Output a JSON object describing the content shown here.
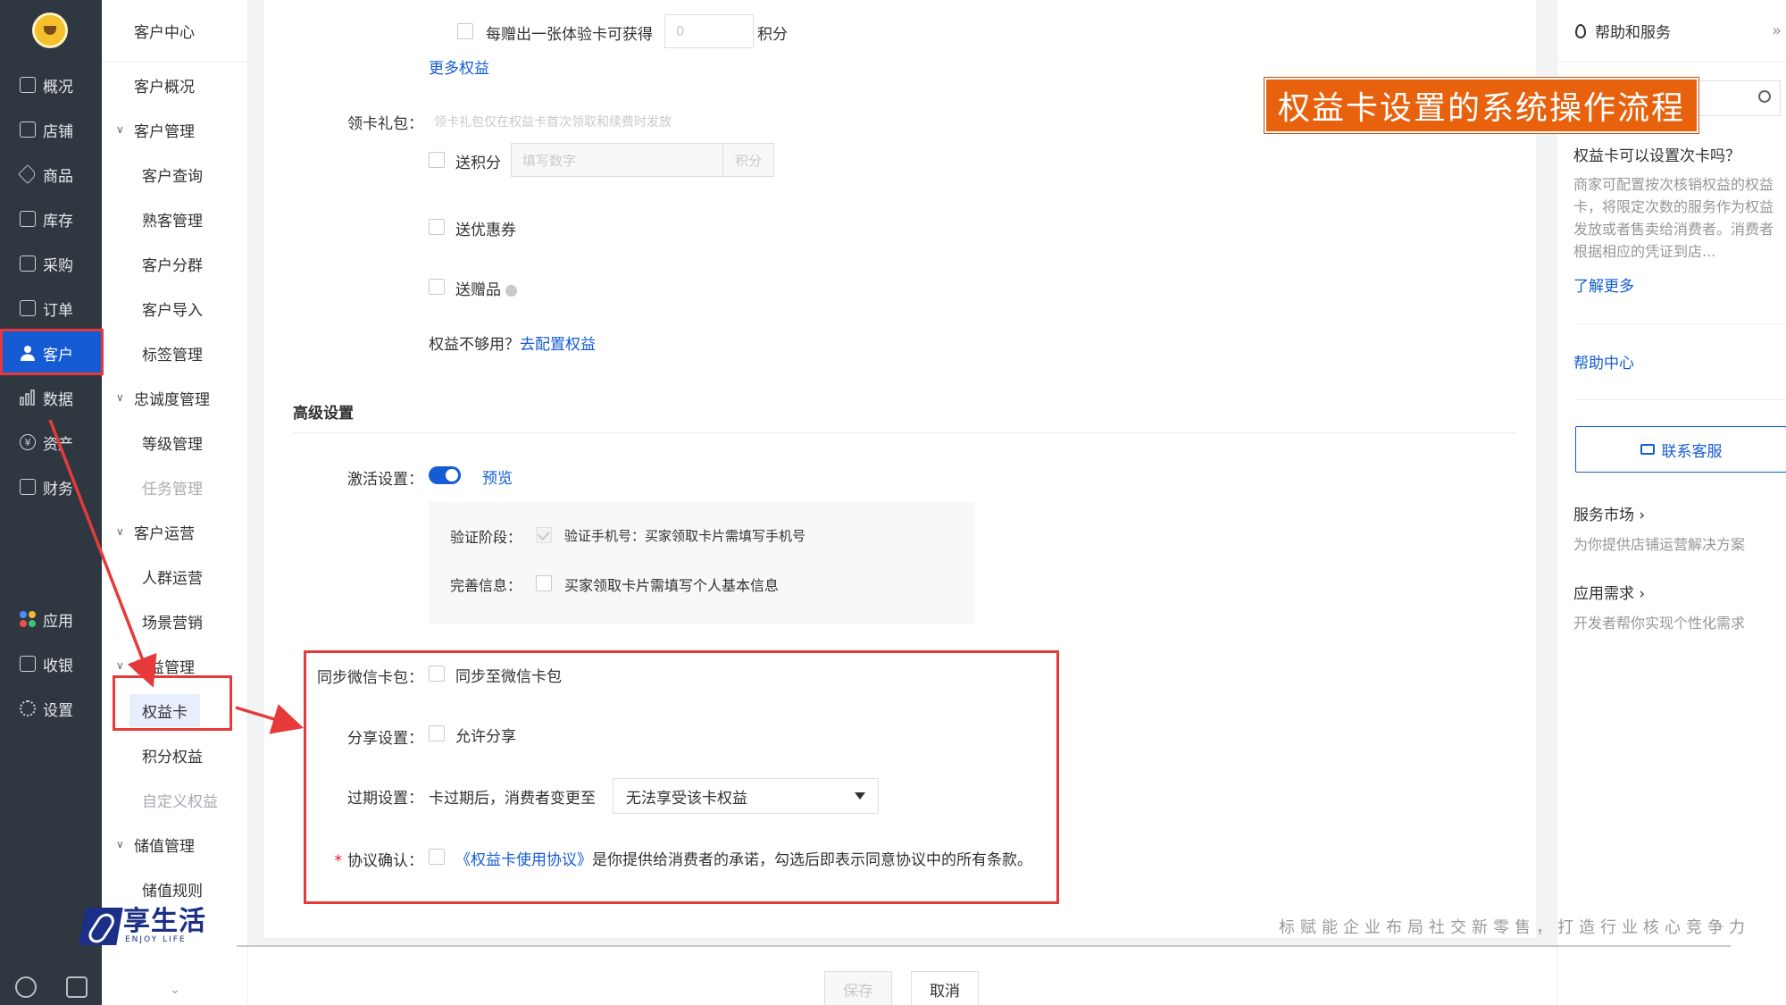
{
  "left_nav": {
    "items": [
      {
        "label": "概况",
        "icon": "monitor-icon"
      },
      {
        "label": "店铺",
        "icon": "store-icon"
      },
      {
        "label": "商品",
        "icon": "tag-icon"
      },
      {
        "label": "库存",
        "icon": "warehouse-icon"
      },
      {
        "label": "采购",
        "icon": "purchase-icon"
      },
      {
        "label": "订单",
        "icon": "list-icon"
      },
      {
        "label": "客户",
        "icon": "user-icon",
        "active": true
      },
      {
        "label": "数据",
        "icon": "bar-chart-icon"
      },
      {
        "label": "资产",
        "icon": "yen-icon"
      },
      {
        "label": "财务",
        "icon": "finance-icon"
      },
      {
        "label": "应用",
        "icon": "apps-icon"
      },
      {
        "label": "收银",
        "icon": "cashier-icon"
      },
      {
        "label": "设置",
        "icon": "gear-icon"
      }
    ],
    "bottom_icons": [
      "search-icon",
      "message-icon"
    ],
    "accent": "#155bd4"
  },
  "sub_nav": {
    "header": "客户中心",
    "items": [
      {
        "label": "客户概况",
        "kind": "top"
      },
      {
        "label": "客户管理",
        "kind": "group"
      },
      {
        "label": "客户查询",
        "kind": "leaf"
      },
      {
        "label": "熟客管理",
        "kind": "leaf"
      },
      {
        "label": "客户分群",
        "kind": "leaf"
      },
      {
        "label": "客户导入",
        "kind": "leaf"
      },
      {
        "label": "标签管理",
        "kind": "leaf"
      },
      {
        "label": "忠诚度管理",
        "kind": "group"
      },
      {
        "label": "等级管理",
        "kind": "leaf"
      },
      {
        "label": "任务管理",
        "kind": "leaf",
        "disabled": true
      },
      {
        "label": "客户运营",
        "kind": "group"
      },
      {
        "label": "人群运营",
        "kind": "leaf"
      },
      {
        "label": "场景营销",
        "kind": "leaf"
      },
      {
        "label": "权益管理",
        "kind": "group"
      },
      {
        "label": "权益卡",
        "kind": "leaf",
        "selected": true
      },
      {
        "label": "积分权益",
        "kind": "leaf"
      },
      {
        "label": "自定义权益",
        "kind": "leaf",
        "disabled": true
      },
      {
        "label": "储值管理",
        "kind": "group"
      },
      {
        "label": "储值规则",
        "kind": "leaf"
      }
    ],
    "more": "⌄"
  },
  "form": {
    "trial_card_checkbox_label": "每赠出一张体验卡可获得",
    "trial_card_points_value": "0",
    "trial_card_points_unit": "积分",
    "more_rights_link": "更多权益",
    "gift_pack_label": "领卡礼包：",
    "gift_pack_hint": "领卡礼包仅在权益卡首次领取和续费时发放",
    "send_points_label": "送积分",
    "send_points_placeholder": "填写数字",
    "send_points_unit": "积分",
    "send_coupon_label": "送优惠券",
    "send_gift_label": "送赠品",
    "rights_insufficient_text": "权益不够用？",
    "rights_config_link": "去配置权益",
    "advanced_title": "高级设置",
    "activation_label": "激活设置：",
    "activation_enabled": true,
    "preview_link": "预览",
    "verify_stage_label": "验证阶段：",
    "verify_stage_text": "验证手机号：买家领取卡片需填写手机号",
    "complete_info_label": "完善信息：",
    "complete_info_text": "买家领取卡片需填写个人基本信息",
    "sync_wechat_label": "同步微信卡包：",
    "sync_wechat_text": "同步至微信卡包",
    "share_label": "分享设置：",
    "share_text": "允许分享",
    "expire_label": "过期设置：",
    "expire_prefix": "卡过期后，消费者变更至",
    "expire_select_value": "无法享受该卡权益",
    "agreement_required_mark": "*",
    "agreement_label": "协议确认：",
    "agreement_link": "《权益卡使用协议》",
    "agreement_text": "是你提供给消费者的承诺，勾选后即表示同意协议中的所有条款。"
  },
  "footer": {
    "save_label": "保存",
    "cancel_label": "取消"
  },
  "help_panel": {
    "title": "帮助和服务",
    "collapse": "»",
    "faq_title": "权益卡可以设置次卡吗？",
    "faq_body": "商家可配置按次核销权益的权益卡，将限定次数的服务作为权益发放或者售卖给消费者。消费者根据相应的凭证到店...",
    "learn_more": "了解更多",
    "help_center": "帮助中心",
    "contact_button": "联系客服",
    "market_title": "服务市场 ›",
    "market_sub": "为你提供店铺运营解决方案",
    "app_title": "应用需求 ›",
    "app_sub": "开发者帮你实现个性化需求"
  },
  "overlay": {
    "banner": "权益卡设置的系统操作流程",
    "brand_name": "享生活",
    "brand_sub": "ENJOY LIFE",
    "slogan": "标赋能企业布局社交新零售，打造行业核心竞争力",
    "annotation_color": "#e63a3a",
    "banner_color": "#e8620e"
  }
}
